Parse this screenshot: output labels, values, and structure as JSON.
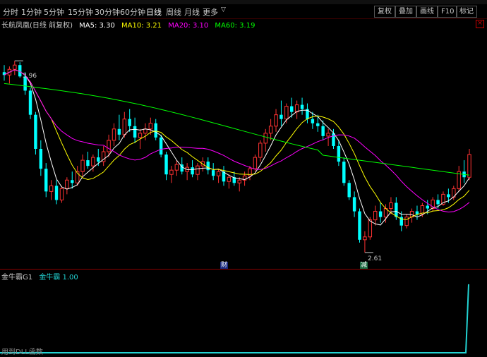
{
  "toolbar": {
    "timeframes": [
      "分时",
      "1分钟",
      "5分钟",
      "15分钟",
      "30分钟",
      "60分钟",
      "日线",
      "周线",
      "月线",
      "更多"
    ],
    "active": "日线",
    "more_arrow": "▽",
    "buttons": [
      "复权",
      "叠加",
      "画线",
      "F10",
      "标记"
    ]
  },
  "legend": {
    "name": "长航凤凰(日线 前复权)",
    "ma5": "MA5: 3.30",
    "ma10": "MA10: 3.21",
    "ma20": "MA20: 3.10",
    "ma60": "MA60: 3.19",
    "close_symbol": "×"
  },
  "annotations": {
    "high_label": "3.96",
    "low_label": "2.61",
    "marker_cai": "财",
    "marker_jian": "减"
  },
  "subpanel": {
    "indicator_name": "金牛霸G1",
    "series_name": "金牛霸",
    "series_value": "1.00",
    "note": "用到DLL函数"
  },
  "colors": {
    "up": "#ff3232",
    "down": "#00ffff",
    "ma5": "#ffffff",
    "ma10": "#ffff00",
    "ma20": "#ff00ff",
    "ma60": "#00ff00",
    "indicator": "#22d3d3"
  },
  "chart_data": {
    "type": "candlestick",
    "ohlc": [
      [
        3.88,
        3.93,
        3.82,
        3.86
      ],
      [
        3.86,
        3.92,
        3.8,
        3.9
      ],
      [
        3.9,
        3.96,
        3.86,
        3.93
      ],
      [
        3.93,
        3.95,
        3.84,
        3.85
      ],
      [
        3.85,
        3.88,
        3.72,
        3.75
      ],
      [
        3.75,
        3.77,
        3.55,
        3.58
      ],
      [
        3.58,
        3.6,
        3.3,
        3.34
      ],
      [
        3.34,
        3.4,
        3.15,
        3.2
      ],
      [
        3.2,
        3.24,
        3.0,
        3.04
      ],
      [
        3.04,
        3.12,
        2.98,
        3.08
      ],
      [
        3.08,
        3.12,
        2.95,
        2.98
      ],
      [
        2.98,
        3.08,
        2.96,
        3.06
      ],
      [
        3.06,
        3.14,
        3.02,
        3.12
      ],
      [
        3.12,
        3.18,
        3.06,
        3.1
      ],
      [
        3.1,
        3.22,
        3.08,
        3.18
      ],
      [
        3.18,
        3.3,
        3.14,
        3.26
      ],
      [
        3.26,
        3.32,
        3.2,
        3.22
      ],
      [
        3.22,
        3.3,
        3.18,
        3.28
      ],
      [
        3.28,
        3.34,
        3.22,
        3.25
      ],
      [
        3.25,
        3.36,
        3.22,
        3.32
      ],
      [
        3.32,
        3.44,
        3.28,
        3.4
      ],
      [
        3.4,
        3.52,
        3.36,
        3.48
      ],
      [
        3.48,
        3.58,
        3.4,
        3.44
      ],
      [
        3.44,
        3.6,
        3.42,
        3.55
      ],
      [
        3.55,
        3.62,
        3.46,
        3.5
      ],
      [
        3.5,
        3.56,
        3.38,
        3.42
      ],
      [
        3.42,
        3.48,
        3.34,
        3.45
      ],
      [
        3.45,
        3.52,
        3.4,
        3.48
      ],
      [
        3.48,
        3.56,
        3.44,
        3.52
      ],
      [
        3.52,
        3.55,
        3.4,
        3.42
      ],
      [
        3.42,
        3.44,
        3.28,
        3.3
      ],
      [
        3.3,
        3.32,
        3.12,
        3.16
      ],
      [
        3.16,
        3.22,
        3.1,
        3.19
      ],
      [
        3.19,
        3.26,
        3.15,
        3.23
      ],
      [
        3.23,
        3.28,
        3.16,
        3.18
      ],
      [
        3.18,
        3.24,
        3.12,
        3.21
      ],
      [
        3.21,
        3.26,
        3.14,
        3.16
      ],
      [
        3.16,
        3.24,
        3.12,
        3.22
      ],
      [
        3.22,
        3.28,
        3.18,
        3.25
      ],
      [
        3.25,
        3.28,
        3.16,
        3.19
      ],
      [
        3.19,
        3.24,
        3.12,
        3.15
      ],
      [
        3.15,
        3.2,
        3.1,
        3.18
      ],
      [
        3.18,
        3.22,
        3.08,
        3.11
      ],
      [
        3.11,
        3.16,
        3.06,
        3.14
      ],
      [
        3.14,
        3.18,
        3.08,
        3.1
      ],
      [
        3.1,
        3.14,
        3.04,
        3.12
      ],
      [
        3.12,
        3.18,
        3.08,
        3.15
      ],
      [
        3.15,
        3.22,
        3.12,
        3.2
      ],
      [
        3.2,
        3.3,
        3.18,
        3.28
      ],
      [
        3.28,
        3.4,
        3.25,
        3.38
      ],
      [
        3.38,
        3.48,
        3.32,
        3.45
      ],
      [
        3.45,
        3.55,
        3.4,
        3.5
      ],
      [
        3.5,
        3.62,
        3.46,
        3.58
      ],
      [
        3.58,
        3.68,
        3.5,
        3.55
      ],
      [
        3.55,
        3.66,
        3.52,
        3.64
      ],
      [
        3.64,
        3.7,
        3.56,
        3.6
      ],
      [
        3.6,
        3.68,
        3.55,
        3.65
      ],
      [
        3.65,
        3.7,
        3.58,
        3.62
      ],
      [
        3.62,
        3.66,
        3.52,
        3.55
      ],
      [
        3.55,
        3.6,
        3.48,
        3.52
      ],
      [
        3.52,
        3.58,
        3.46,
        3.5
      ],
      [
        3.5,
        3.54,
        3.4,
        3.43
      ],
      [
        3.43,
        3.48,
        3.36,
        3.45
      ],
      [
        3.45,
        3.48,
        3.34,
        3.36
      ],
      [
        3.36,
        3.4,
        3.22,
        3.25
      ],
      [
        3.25,
        3.28,
        3.08,
        3.1
      ],
      [
        3.1,
        3.12,
        2.98,
        3.0
      ],
      [
        3.0,
        3.04,
        2.86,
        2.9
      ],
      [
        2.9,
        2.92,
        2.68,
        2.7
      ],
      [
        2.7,
        2.76,
        2.61,
        2.72
      ],
      [
        2.72,
        2.86,
        2.7,
        2.84
      ],
      [
        2.84,
        2.94,
        2.8,
        2.9
      ],
      [
        2.9,
        2.96,
        2.82,
        2.86
      ],
      [
        2.86,
        2.95,
        2.82,
        2.92
      ],
      [
        2.92,
        3.0,
        2.88,
        2.96
      ],
      [
        2.96,
        3.0,
        2.84,
        2.86
      ],
      [
        2.86,
        2.9,
        2.76,
        2.8
      ],
      [
        2.8,
        2.88,
        2.78,
        2.86
      ],
      [
        2.86,
        2.92,
        2.82,
        2.9
      ],
      [
        2.9,
        2.94,
        2.84,
        2.88
      ],
      [
        2.88,
        2.96,
        2.86,
        2.94
      ],
      [
        2.94,
        2.98,
        2.88,
        2.92
      ],
      [
        2.92,
        3.0,
        2.9,
        2.98
      ],
      [
        2.98,
        3.02,
        2.92,
        2.95
      ],
      [
        2.95,
        3.04,
        2.94,
        3.02
      ],
      [
        3.02,
        3.06,
        2.96,
        3.0
      ],
      [
        3.0,
        3.08,
        2.98,
        3.06
      ],
      [
        3.06,
        3.22,
        3.04,
        3.18
      ],
      [
        3.18,
        3.26,
        3.1,
        3.14
      ],
      [
        3.14,
        3.34,
        3.12,
        3.3
      ]
    ],
    "ma_periods": [
      5,
      10,
      20,
      60
    ],
    "ylim": [
      2.55,
      4.1
    ],
    "indicator": {
      "name": "金牛霸",
      "values_tail_from": 89,
      "level": 1.0,
      "ylim": [
        0,
        1.05
      ]
    }
  }
}
